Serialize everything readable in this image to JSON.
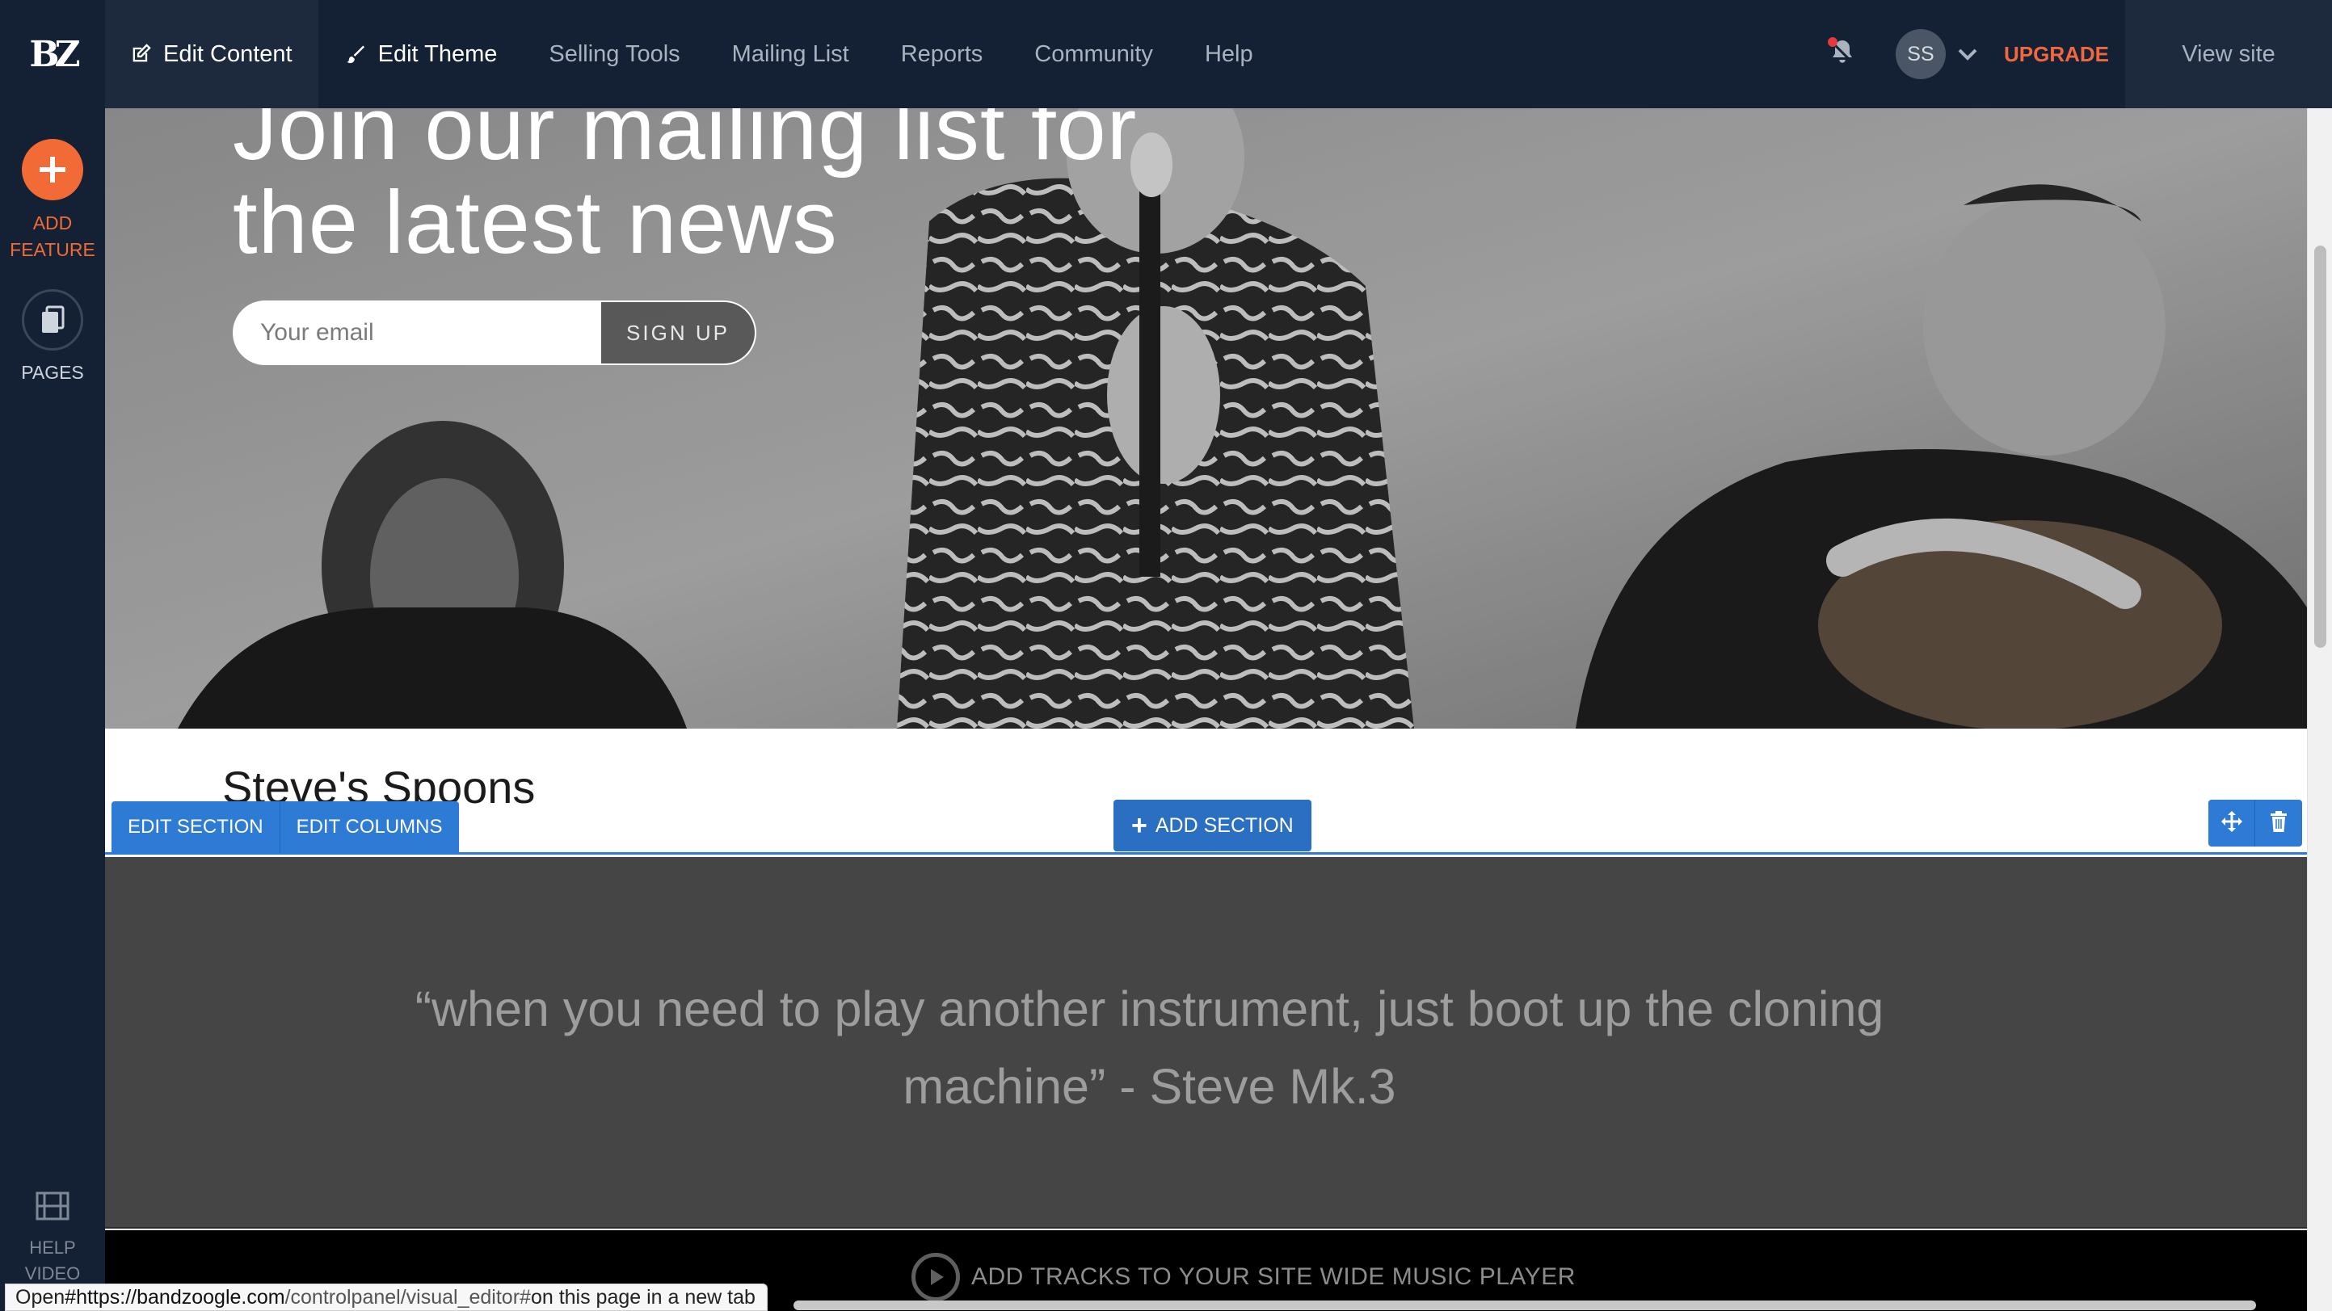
{
  "nav": {
    "logo": "BZ",
    "items": [
      {
        "label": "Edit Content",
        "icon": "edit-icon"
      },
      {
        "label": "Edit Theme",
        "icon": "brush-icon"
      },
      {
        "label": "Selling Tools"
      },
      {
        "label": "Mailing List"
      },
      {
        "label": "Reports"
      },
      {
        "label": "Community"
      },
      {
        "label": "Help"
      }
    ],
    "avatar_initials": "SS",
    "upgrade": "UPGRADE",
    "view_site": "View site"
  },
  "sidebar": {
    "add_feature": "ADD FEATURE",
    "pages": "PAGES",
    "help_video": "HELP VIDEO"
  },
  "hero": {
    "title": "Join our mailing list for the latest news",
    "email_placeholder": "Your email",
    "signup_label": "SIGN UP"
  },
  "band_section": {
    "name": "Steve's Spoons",
    "edit_section": "EDIT SECTION",
    "edit_columns": "EDIT COLUMNS",
    "add_section": "ADD SECTION"
  },
  "quote": {
    "text": "“when you need to play another instrument, just boot up the cloning machine” - Steve Mk.3"
  },
  "player": {
    "label": "ADD TRACKS TO YOUR SITE WIDE MUSIC PLAYER"
  },
  "status_bar": {
    "prefix": "Open ",
    "host": "#https://bandzoogle.com",
    "path": "/controlpanel/visual_editor#",
    "suffix": " on this page in a new tab"
  },
  "colors": {
    "nav_bg": "#142033",
    "accent_orange": "#f26a36",
    "editor_blue": "#2e7bd6",
    "quote_bg": "#454545"
  }
}
